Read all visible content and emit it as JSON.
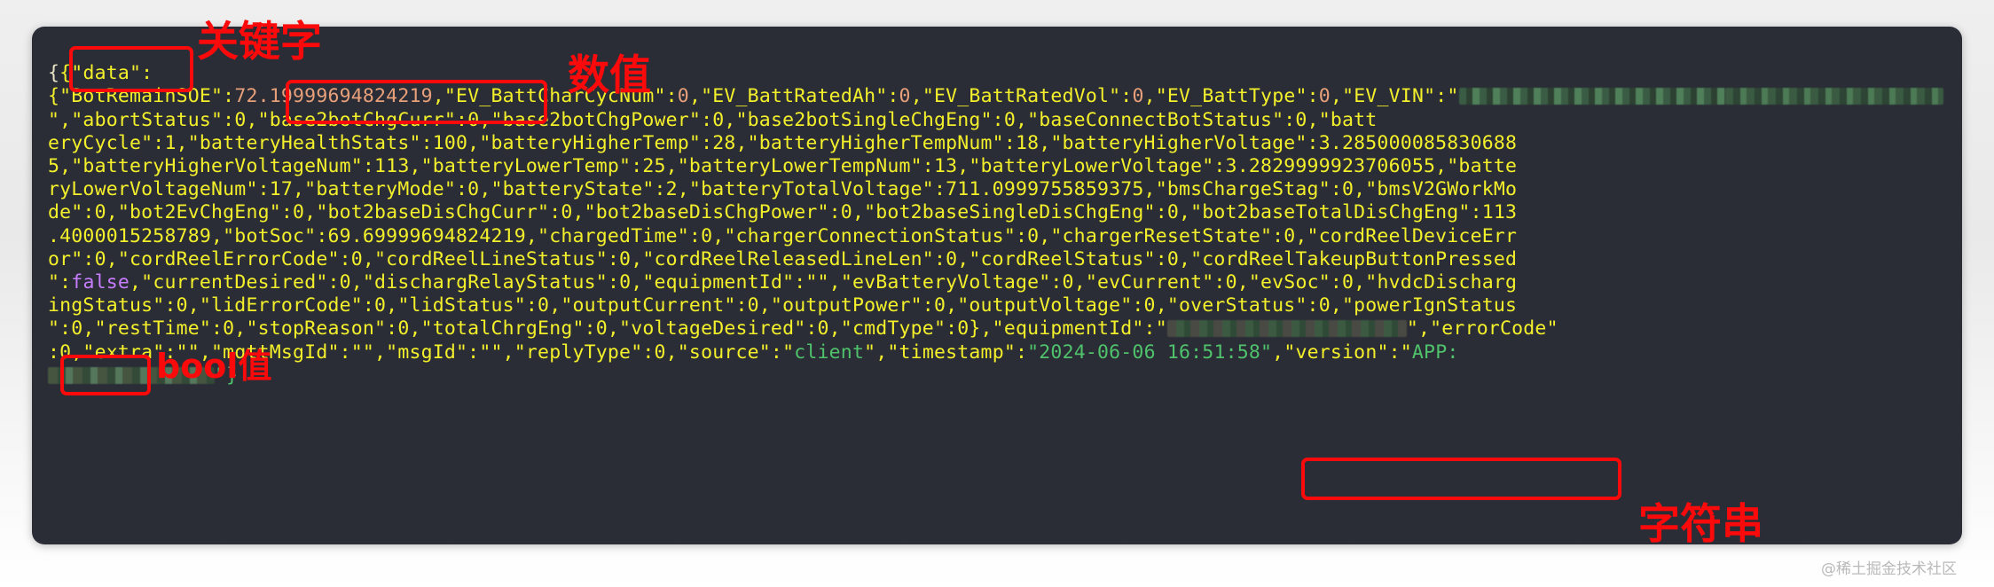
{
  "panel": {
    "background_color": "#2b2d36",
    "colors": {
      "key": "#f3f02b",
      "number": "#e8a07a",
      "string": "#4fc26b",
      "boolean": "#c77dff",
      "punctuation": "#e9e6c8",
      "annotation": "#fa0a0a"
    }
  },
  "code": {
    "line1": "{\"data\":",
    "line2_a": "{\"BotRemainSOE\":",
    "line2_num": "72.19999694824219",
    "line2_b": ",\"EV_BattCharCycNum\":",
    "line2_c": "0",
    "line2_d": ",\"EV_BattRatedAh\":",
    "line2_e": "0",
    "line2_f": ",\"EV_BattRatedVol\":",
    "line2_g": "0",
    "line2_h": ",\"EV_BattType\":",
    "line2_i": "0",
    "line2_j": ",\"EV_VIN\":\"",
    "line3_tail": "\",\"abortStatus\":",
    "line3": "0,\"base2botChgCurr\":0,\"base2botChgPower\":0,\"base2botSingleChgEng\":0,\"baseConnectBotStatus\":0,\"batt",
    "line4": "eryCycle\":1,\"batteryHealthStats\":100,\"batteryHigherTemp\":28,\"batteryHigherTempNum\":18,\"batteryHigherVoltage\":3.285000085830688",
    "line5": "5,\"batteryHigherVoltageNum\":113,\"batteryLowerTemp\":25,\"batteryLowerTempNum\":13,\"batteryLowerVoltage\":3.2829999923706055,\"batte",
    "line6": "ryLowerVoltageNum\":17,\"batteryMode\":0,\"batteryState\":2,\"batteryTotalVoltage\":711.0999755859375,\"bmsChargeStag\":0,\"bmsV2GWorkMo",
    "line7": "de\":0,\"bot2EvChgEng\":0,\"bot2baseDisChgCurr\":0,\"bot2baseDisChgPower\":0,\"bot2baseSingleDisChgEng\":0,\"bot2baseTotalDisChgEng\":113",
    "line8": ".4000015258789,\"botSoc\":69.69999694824219,\"chargedTime\":0,\"chargerConnectionStatus\":0,\"chargerResetState\":0,\"cordReelDeviceErr",
    "line9": "or\":0,\"cordReelErrorCode\":0,\"cordReelLineStatus\":0,\"cordReelReleasedLineLen\":0,\"cordReelStatus\":0,\"cordReelTakeupButtonPressed",
    "line10_a": "\":",
    "line10_bool": "false",
    "line10_b": ",\"currentDesired\":0,\"dischargRelayStatus\":0,\"equipmentId\":\"\",\"evBatteryVoltage\":0,\"evCurrent\":0,\"evSoc\":0,\"hvdcDischarg",
    "line11": "ingStatus\":0,\"lidErrorCode\":0,\"lidStatus\":0,\"outputCurrent\":0,\"outputPower\":0,\"outputVoltage\":0,\"overStatus\":0,\"powerIgnStatus",
    "line12_a": "\":0,\"restTime\":0,\"stopReason\":0,\"totalChrgEng\":0,\"voltageDesired\":0,\"cmdType\":0},\"equipmentId\":\"",
    "line12_b": "\",\"errorCode\"",
    "line13_a": ":0,\"extra\":\"\",\"mqttMsgId\":\"\",\"msgId\":\"\",\"replyType\":0,\"source\":\"",
    "line13_source": "client",
    "line13_b": "\",\"timestamp\":",
    "line13_timestamp": "\"2024-06-06 16:51:58\"",
    "line13_c": ",\"version\":\"",
    "line13_version": "APP:",
    "line14_tail": "\"}"
  },
  "annotations": {
    "keyword": "关键字",
    "number": "数值",
    "boolean": "bool值",
    "string": "字符串"
  },
  "watermark": "@稀土掘金技术社区"
}
